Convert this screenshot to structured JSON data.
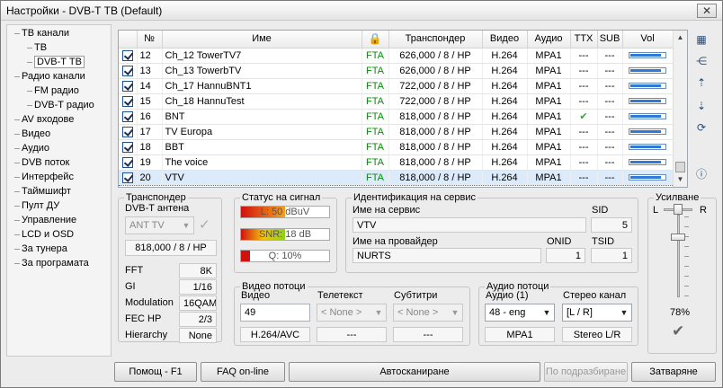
{
  "window": {
    "title": "Настройки - DVB-T ТВ (Default)",
    "close_glyph": "✕"
  },
  "tree": [
    {
      "label": "ТВ канали",
      "expandable": true
    },
    {
      "label": "ТВ",
      "child": true
    },
    {
      "label": "DVB-T ТВ",
      "child": true,
      "selected": true
    },
    {
      "label": "Радио канали",
      "expandable": true
    },
    {
      "label": "FM радио",
      "child": true
    },
    {
      "label": "DVB-T радио",
      "child": true
    },
    {
      "label": "AV входове"
    },
    {
      "label": "Видео"
    },
    {
      "label": "Аудио"
    },
    {
      "label": "DVB поток"
    },
    {
      "label": "Интерфейс"
    },
    {
      "label": "Таймшифт"
    },
    {
      "label": "Пулт ДУ"
    },
    {
      "label": "Управление"
    },
    {
      "label": "LCD и OSD"
    },
    {
      "label": "За тунера"
    },
    {
      "label": "За програмата"
    }
  ],
  "channels": {
    "headers": [
      "",
      "№",
      "Име",
      "",
      "Транспондер",
      "Видео",
      "Аудио",
      "TTX",
      "SUB",
      "Vol"
    ],
    "rows": [
      {
        "checked": true,
        "num": "12",
        "name": "Ch_12 TowerTV7",
        "access": "FTA",
        "transponder": "626,000 / 8 / HP",
        "video": "H.264",
        "audio": "MPA1",
        "ttx": "---",
        "sub": "---",
        "vol": 0.9
      },
      {
        "checked": true,
        "num": "13",
        "name": "Ch_13 TowerbTV",
        "access": "FTA",
        "transponder": "626,000 / 8 / HP",
        "video": "H.264",
        "audio": "MPA1",
        "ttx": "---",
        "sub": "---",
        "vol": 0.9
      },
      {
        "checked": true,
        "num": "14",
        "name": "Ch_17 HannuBNT1",
        "access": "FTA",
        "transponder": "722,000 / 8 / HP",
        "video": "H.264",
        "audio": "MPA1",
        "ttx": "---",
        "sub": "---",
        "vol": 0.9
      },
      {
        "checked": true,
        "num": "15",
        "name": "Ch_18 HannuTest",
        "access": "FTA",
        "transponder": "722,000 / 8 / HP",
        "video": "H.264",
        "audio": "MPA1",
        "ttx": "---",
        "sub": "---",
        "vol": 0.9
      },
      {
        "checked": true,
        "num": "16",
        "name": "BNT",
        "access": "FTA",
        "transponder": "818,000 / 8 / HP",
        "video": "H.264",
        "audio": "MPA1",
        "ttx": "✔",
        "sub": "---",
        "vol": 0.9
      },
      {
        "checked": true,
        "num": "17",
        "name": "TV Europa",
        "access": "FTA",
        "transponder": "818,000 / 8 / HP",
        "video": "H.264",
        "audio": "MPA1",
        "ttx": "---",
        "sub": "---",
        "vol": 0.9
      },
      {
        "checked": true,
        "num": "18",
        "name": "BBT",
        "access": "FTA",
        "transponder": "818,000 / 8 / HP",
        "video": "H.264",
        "audio": "MPA1",
        "ttx": "---",
        "sub": "---",
        "vol": 0.9
      },
      {
        "checked": true,
        "num": "19",
        "name": "The voice",
        "access": "FTA",
        "transponder": "818,000 / 8 / HP",
        "video": "H.264",
        "audio": "MPA1",
        "ttx": "---",
        "sub": "---",
        "vol": 0.9
      },
      {
        "checked": true,
        "num": "20",
        "name": "VTV",
        "access": "FTA",
        "transponder": "818,000 / 8 / HP",
        "video": "H.264",
        "audio": "MPA1",
        "ttx": "---",
        "sub": "---",
        "vol": 0.9,
        "selected": true
      }
    ]
  },
  "transponder": {
    "legend": "Транспондер",
    "antenna_label": "DVB-T антена",
    "antenna_value": "ANT TV",
    "frequency": "818,000 / 8 / HP",
    "fft_label": "FFT",
    "fft_value": "8K",
    "gi_label": "GI",
    "gi_value": "1/16",
    "mod_label": "Modulation",
    "mod_value": "16QAM",
    "fec_label": "FEC HP",
    "fec_value": "2/3",
    "hier_label": "Hierarchy",
    "hier_value": "None"
  },
  "signal": {
    "legend": "Статус на сигнал",
    "level_text": "L: 50 dBuV",
    "level": 0.5,
    "snr_text": "SNR: 18 dB",
    "snr": 0.5,
    "quality_text": "Q: 10%",
    "quality": 0.1
  },
  "service_id": {
    "legend": "Идентификация на сервис",
    "service_label": "Име на сервис",
    "service_value": "VTV",
    "sid_label": "SID",
    "sid_value": "5",
    "provider_label": "Име на провайдер",
    "provider_value": "NURTS",
    "onid_label": "ONID",
    "onid_value": "1",
    "tsid_label": "TSID",
    "tsid_value": "1"
  },
  "video_streams": {
    "legend": "Видео потоци",
    "video_label": "Видео",
    "video_value": "49",
    "video_codec": "H.264/AVC",
    "teletext_label": "Телетекст",
    "teletext_value": "< None >",
    "teletext_info": "---",
    "subs_label": "Субтитри",
    "subs_value": "< None >",
    "subs_info": "---"
  },
  "audio_streams": {
    "legend": "Аудио потоци",
    "audio_label": "Аудио (1)",
    "audio_value": "48 - eng",
    "audio_codec": "MPA1",
    "stereo_label": "Стерео канал",
    "stereo_value": "[L / R]",
    "stereo_info": "Stereo L/R"
  },
  "gain": {
    "legend": "Усилване",
    "left": "L",
    "right": "R",
    "balance": 0.5,
    "level": 0.78,
    "percent": "78%"
  },
  "buttons": {
    "help": "Помощ - F1",
    "faq": "FAQ on-line",
    "autoscan": "Автосканиране",
    "defaults": "По подразбиране",
    "close": "Затваряне"
  },
  "colors": {
    "fta": "#0a8a0a",
    "selection": "#dcebfb",
    "volume": "#2f7ad8"
  }
}
